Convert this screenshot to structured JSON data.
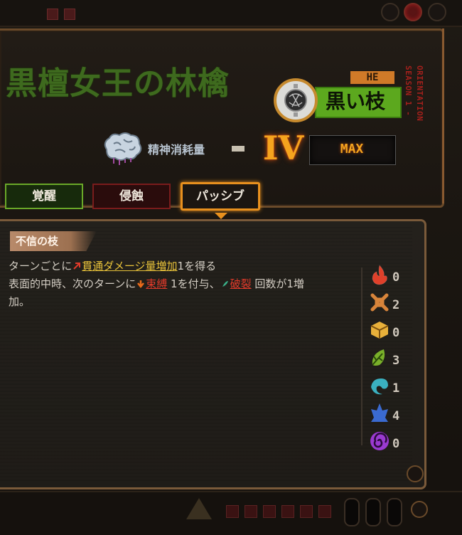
{
  "ego": {
    "title": "黒檀女王の林檎",
    "risk_level": "HE",
    "name": "黒い枝",
    "season_line1": "SEASON 1 -",
    "season_line2": "ORIENTATION"
  },
  "sanity": {
    "label": "精神消耗量",
    "dash": "-",
    "level": "IV",
    "max_label": "MAX"
  },
  "tabs": [
    {
      "label": "覚醒",
      "active": false
    },
    {
      "label": "侵蝕",
      "active": false
    },
    {
      "label": "パッシブ",
      "active": true
    }
  ],
  "passive": {
    "name": "不信の枝",
    "line1_a": "ターンごとに",
    "line1_kw": "貫通ダメージ量増加",
    "line1_b": "1を得る",
    "line2_a": "表面的中時、次のターンに",
    "line2_kw1": "束縛",
    "line2_b": " 1を付与、",
    "line2_kw2": "破裂",
    "line2_c": " 回数が1増",
    "line3": "加。"
  },
  "resources": [
    {
      "name": "wrath",
      "icon": "flame-icon",
      "color": "#e0402a",
      "count": "0"
    },
    {
      "name": "lust",
      "icon": "chain-icon",
      "color": "#d8843a",
      "count": "2"
    },
    {
      "name": "sloth",
      "icon": "block-icon",
      "color": "#e8b03a",
      "count": "0"
    },
    {
      "name": "gluttony",
      "icon": "leaf-icon",
      "color": "#7ab02a",
      "count": "3"
    },
    {
      "name": "gloom",
      "icon": "wave-icon",
      "color": "#3ab0c0",
      "count": "1"
    },
    {
      "name": "pride",
      "icon": "crystal-icon",
      "color": "#3a6ad0",
      "count": "4"
    },
    {
      "name": "envy",
      "icon": "spiral-icon",
      "color": "#9a3ad0",
      "count": "0"
    }
  ],
  "colors": {
    "accent_orange": "#e8901e",
    "title_green": "#3e6a1e",
    "keyword_yellow": "#e8c23a",
    "keyword_red": "#e03a2a"
  }
}
